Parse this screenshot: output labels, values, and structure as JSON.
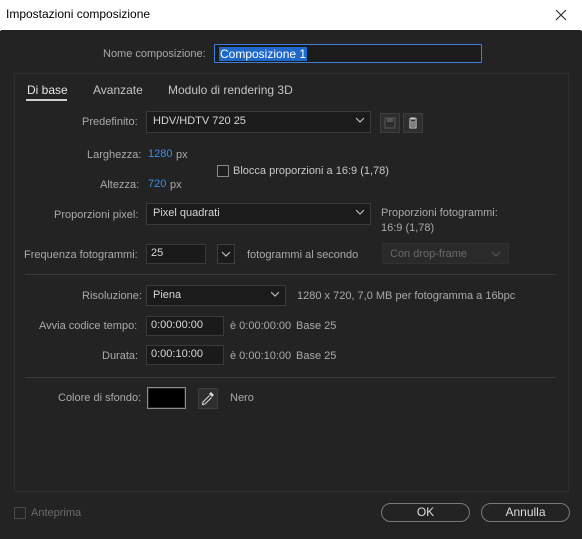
{
  "window": {
    "title": "Impostazioni composizione"
  },
  "comp_name": {
    "label": "Nome composizione:",
    "value": "Composizione 1"
  },
  "tabs": [
    {
      "label": "Di base"
    },
    {
      "label": "Avanzate"
    },
    {
      "label": "Modulo di rendering 3D"
    }
  ],
  "preset": {
    "label": "Predefinito:",
    "value": "HDV/HDTV 720 25"
  },
  "width": {
    "label": "Larghezza:",
    "value": "1280",
    "unit": "px"
  },
  "height": {
    "label": "Altezza:",
    "value": "720",
    "unit": "px"
  },
  "lock_ratio": {
    "label": "Blocca proporzioni a 16:9 (1,78)",
    "checked": false
  },
  "pixel_aspect": {
    "label": "Proporzioni pixel:",
    "value": "Pixel quadrati"
  },
  "frame_aspect": {
    "label": "Proporzioni fotogrammi:",
    "value": "16:9 (1,78)"
  },
  "frame_rate": {
    "label": "Frequenza fotogrammi:",
    "value": "25",
    "unit": "fotogrammi al secondo",
    "dropframe": "Con drop-frame"
  },
  "resolution": {
    "label": "Risoluzione:",
    "value": "Piena",
    "info": "1280 x 720, 7,0 MB per fotogramma a 16bpc"
  },
  "start_tc": {
    "label": "Avvia codice tempo:",
    "value": "0:00:00:00",
    "equals": "è 0:00:00:00",
    "base": "Base 25"
  },
  "duration": {
    "label": "Durata:",
    "value": "0:00:10:00",
    "equals": "è 0:00:10:00",
    "base": "Base 25"
  },
  "bg_color": {
    "label": "Colore di sfondo:",
    "swatch": "#000000",
    "name": "Nero"
  },
  "footer": {
    "preview_label": "Anteprima",
    "ok_label": "OK",
    "cancel_label": "Annulla"
  },
  "colors": {
    "accent": "#3b8ee8",
    "selection": "#1f68c8"
  }
}
